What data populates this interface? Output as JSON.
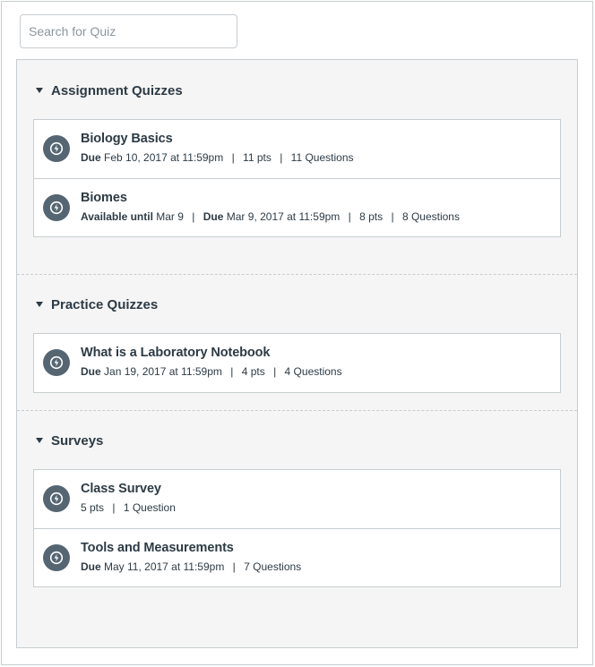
{
  "search": {
    "placeholder": "Search for Quiz"
  },
  "groups": [
    {
      "title": "Assignment Quizzes",
      "items": [
        {
          "title": "Biology Basics",
          "due_label": "Due",
          "due": "Feb 10, 2017 at 11:59pm",
          "points": "11 pts",
          "questions": "11 Questions"
        },
        {
          "title": "Biomes",
          "avail_label": "Available until",
          "avail": "Mar 9",
          "due_label": "Due",
          "due": "Mar 9, 2017 at 11:59pm",
          "points": "8 pts",
          "questions": "8 Questions"
        }
      ]
    },
    {
      "title": "Practice Quizzes",
      "items": [
        {
          "title": "What is a Laboratory Notebook",
          "due_label": "Due",
          "due": "Jan 19, 2017 at 11:59pm",
          "points": "4 pts",
          "questions": "4 Questions"
        }
      ]
    },
    {
      "title": "Surveys",
      "items": [
        {
          "title": "Class Survey",
          "points": "5 pts",
          "questions": "1 Question"
        },
        {
          "title": "Tools and Measurements",
          "due_label": "Due",
          "due": "May 11, 2017 at 11:59pm",
          "questions": "7 Questions"
        }
      ]
    }
  ],
  "separator": "|",
  "icon": "quiz-rocket-icon",
  "colors": {
    "icon_bg": "#556572",
    "text": "#2d3b45",
    "border": "#c7cdd1",
    "panel_bg": "#f5f5f5"
  }
}
